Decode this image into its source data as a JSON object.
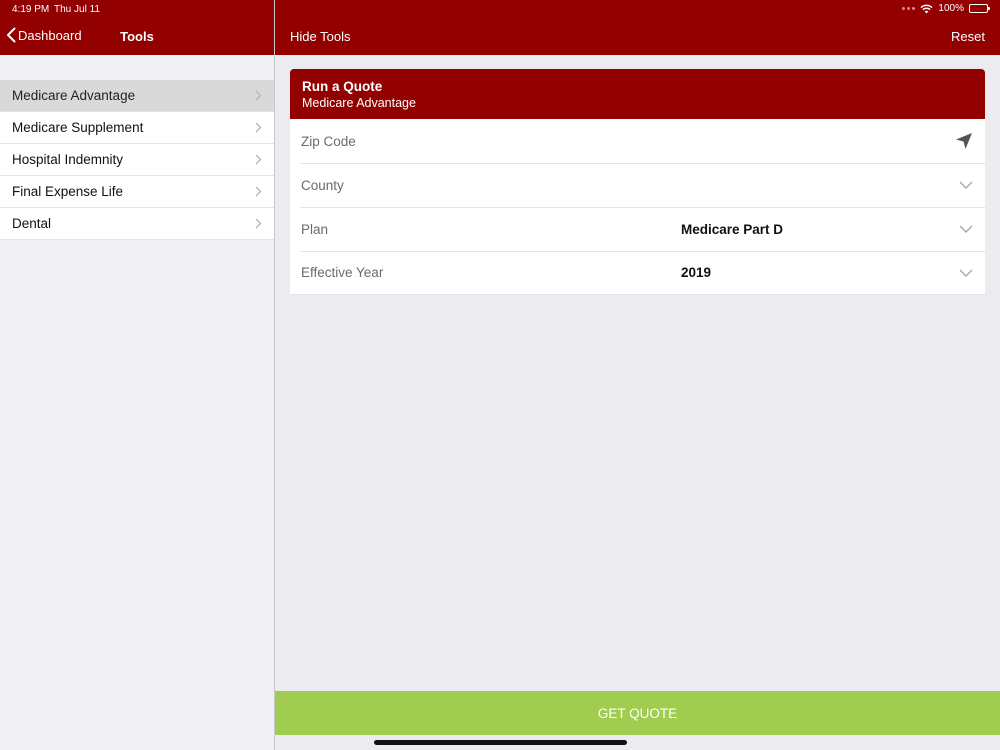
{
  "status": {
    "time": "4:19 PM",
    "date": "Thu Jul 11",
    "battery": "100%"
  },
  "sidebar": {
    "back_label": "Dashboard",
    "title": "Tools",
    "items": [
      {
        "label": "Medicare Advantage"
      },
      {
        "label": "Medicare Supplement"
      },
      {
        "label": "Hospital Indemnity"
      },
      {
        "label": "Final Expense Life"
      },
      {
        "label": "Dental"
      }
    ]
  },
  "main": {
    "hide_label": "Hide Tools",
    "reset_label": "Reset",
    "card": {
      "title": "Run a Quote",
      "subtitle": "Medicare Advantage",
      "rows": [
        {
          "label": "Zip Code",
          "value": "",
          "icon": "location-arrow-icon"
        },
        {
          "label": "County",
          "value": "",
          "icon": "chevron-down-icon"
        },
        {
          "label": "Plan",
          "value": "Medicare Part D",
          "icon": "chevron-down-icon"
        },
        {
          "label": "Effective Year",
          "value": "2019",
          "icon": "chevron-down-icon"
        }
      ]
    },
    "get_quote_label": "GET QUOTE"
  },
  "colors": {
    "brand": "#920000",
    "accent": "#a0cc50",
    "selected_row": "#d9d9d9"
  }
}
